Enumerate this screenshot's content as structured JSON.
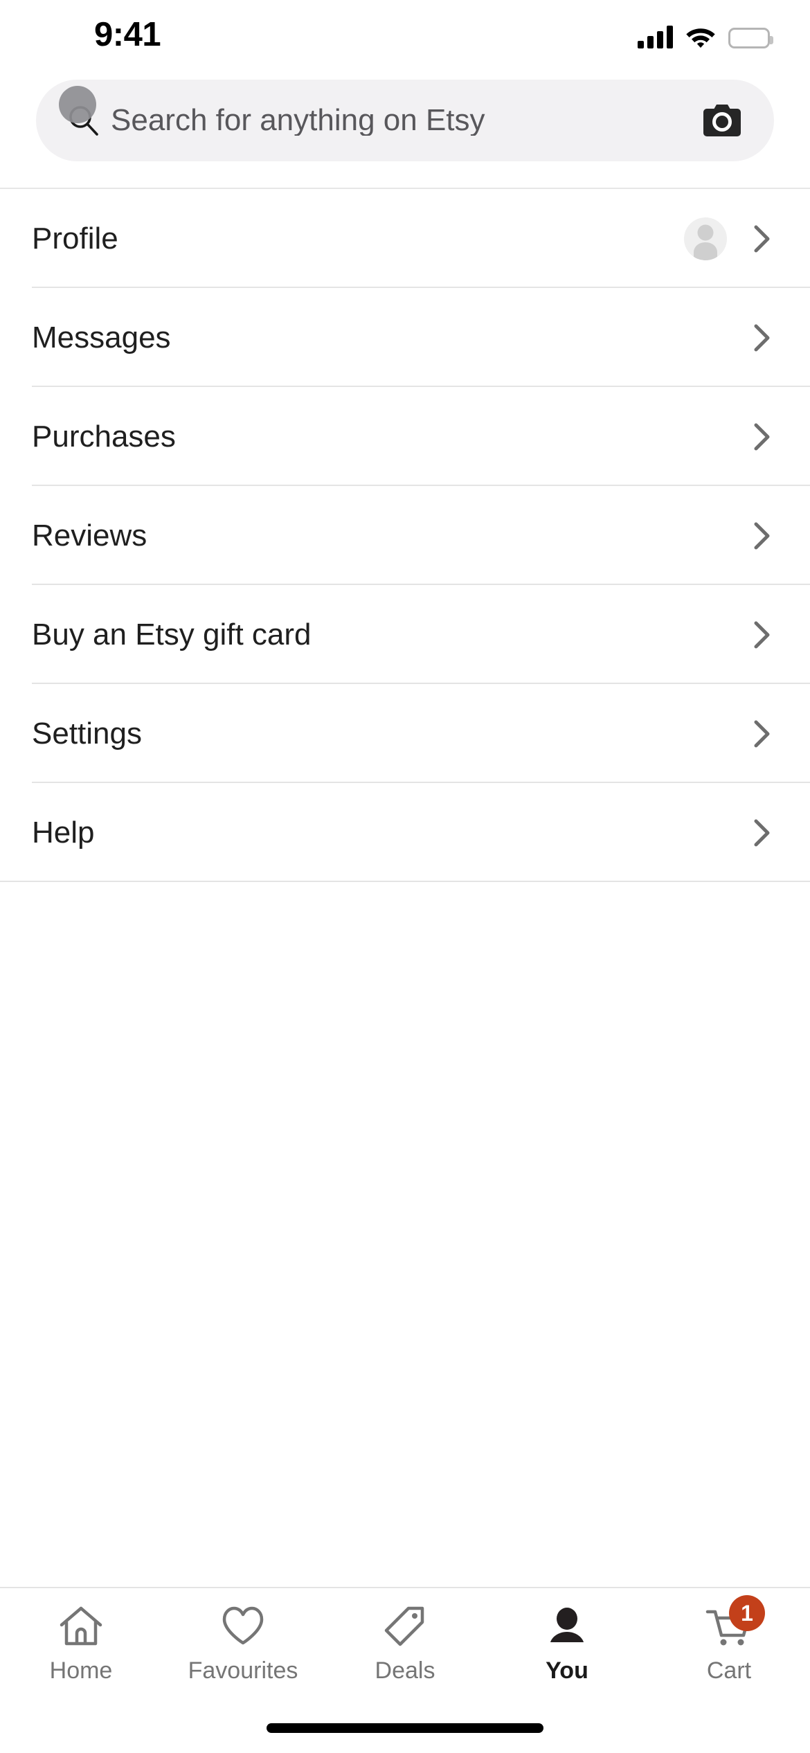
{
  "status_bar": {
    "time": "9:41",
    "signal_icon": "cellular-signal-icon",
    "wifi_icon": "wifi-icon",
    "battery_icon": "battery-full-icon",
    "signal_bars": 4,
    "battery_level": 100
  },
  "search": {
    "placeholder": "Search for anything on Etsy",
    "value": "",
    "search_icon": "search-icon",
    "camera_icon": "camera-icon"
  },
  "menu": {
    "items": [
      {
        "label": "Profile",
        "has_avatar": true,
        "chevron": "chevron-right-icon"
      },
      {
        "label": "Messages",
        "has_avatar": false,
        "chevron": "chevron-right-icon"
      },
      {
        "label": "Purchases",
        "has_avatar": false,
        "chevron": "chevron-right-icon"
      },
      {
        "label": "Reviews",
        "has_avatar": false,
        "chevron": "chevron-right-icon"
      },
      {
        "label": "Buy an Etsy gift card",
        "has_avatar": false,
        "chevron": "chevron-right-icon"
      },
      {
        "label": "Settings",
        "has_avatar": false,
        "chevron": "chevron-right-icon"
      },
      {
        "label": "Help",
        "has_avatar": false,
        "chevron": "chevron-right-icon"
      }
    ]
  },
  "tab_bar": {
    "items": [
      {
        "label": "Home",
        "icon": "home-icon",
        "active": false,
        "badge": ""
      },
      {
        "label": "Favourites",
        "icon": "heart-icon",
        "active": false,
        "badge": ""
      },
      {
        "label": "Deals",
        "icon": "tag-icon",
        "active": false,
        "badge": ""
      },
      {
        "label": "You",
        "icon": "person-icon",
        "active": true,
        "badge": ""
      },
      {
        "label": "Cart",
        "icon": "shopping-cart-icon",
        "active": false,
        "badge": "1"
      }
    ]
  },
  "colors": {
    "badge_red": "#c3401a",
    "search_field_bg": "#f2f1f3",
    "separator": "#e4e4e4",
    "inactive_tab": "#757575",
    "active_tab": "#1a1a1a",
    "placeholder_text": "#58575b"
  }
}
